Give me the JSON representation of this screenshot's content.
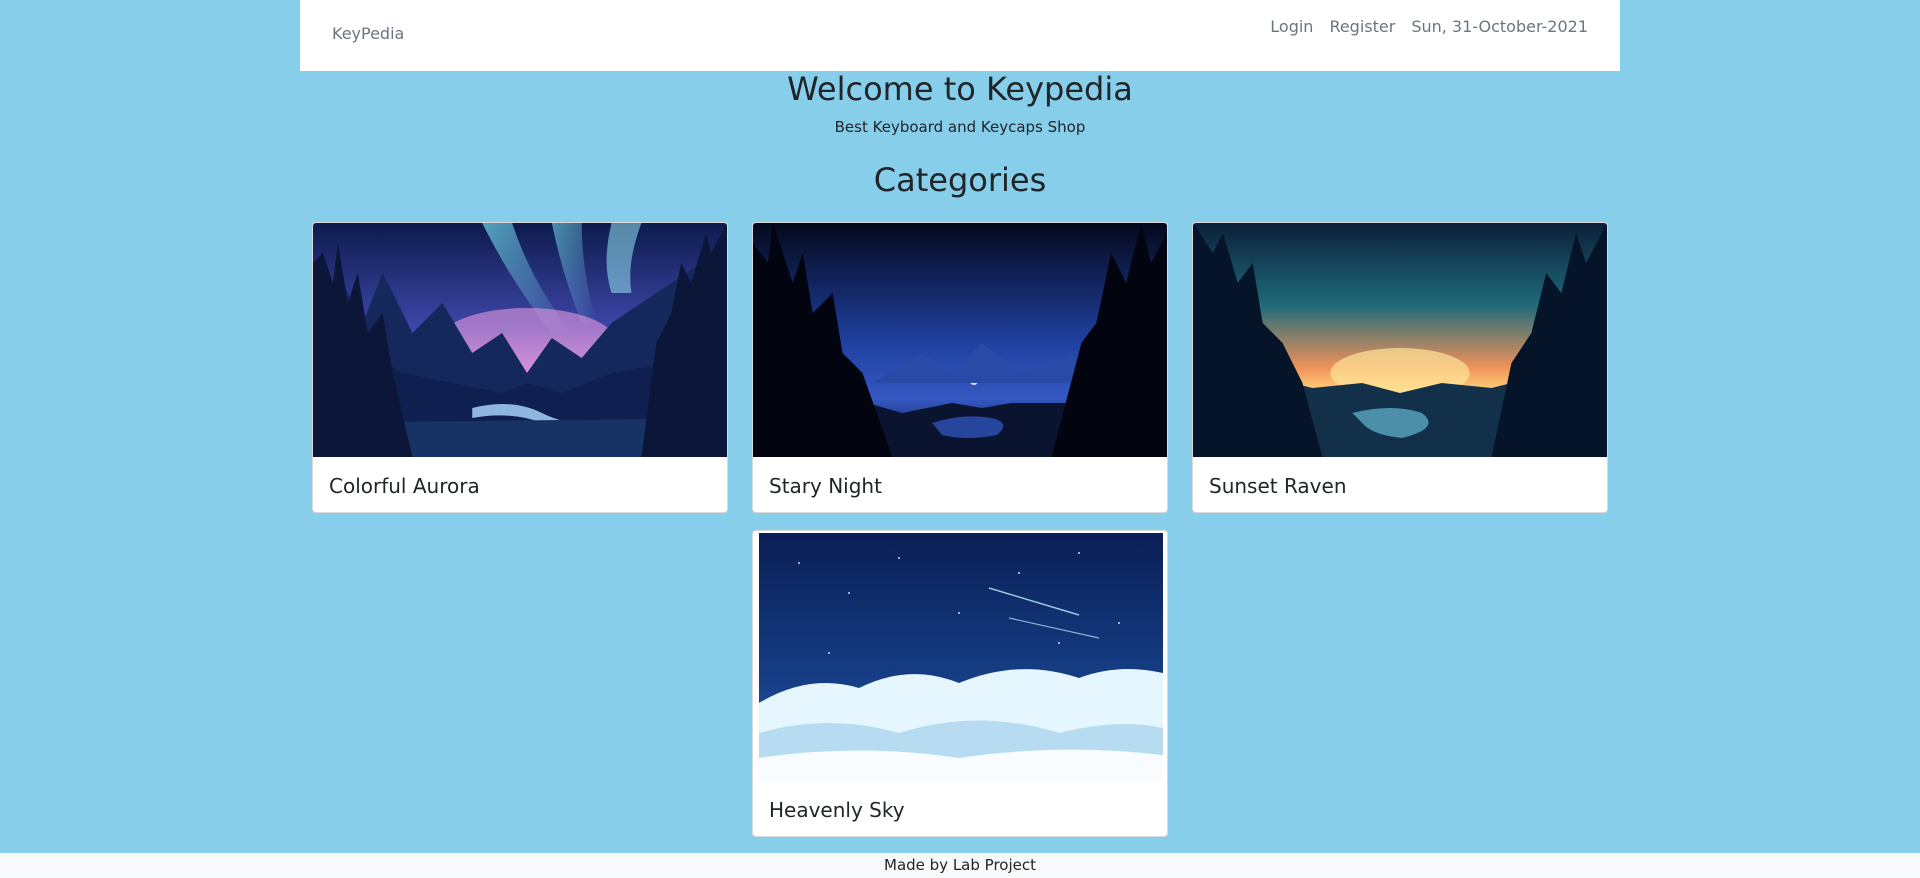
{
  "navbar": {
    "brand": "KeyPedia",
    "login": "Login",
    "register": "Register",
    "date": "Sun, 31-October-2021"
  },
  "hero": {
    "title": "Welcome to Keypedia",
    "subtitle": "Best Keyboard and Keycaps Shop"
  },
  "categories": {
    "heading": "Categories",
    "items": [
      {
        "title": "Colorful Aurora"
      },
      {
        "title": "Stary Night"
      },
      {
        "title": "Sunset Raven"
      },
      {
        "title": "Heavenly Sky"
      }
    ]
  },
  "footer": {
    "text": "Made by Lab Project"
  },
  "colors": {
    "background": "#87ceeb",
    "navbar": "#ffffff",
    "muted_text": "#6c757d"
  }
}
